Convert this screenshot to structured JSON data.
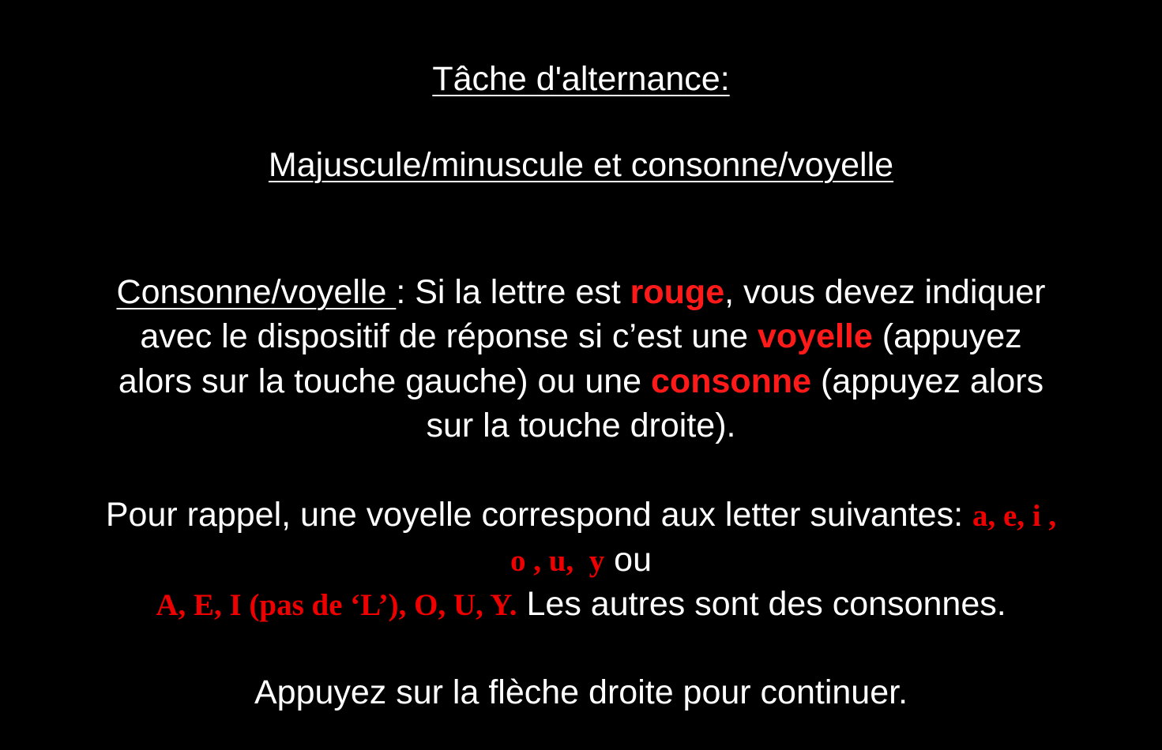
{
  "colors": {
    "background": "#000000",
    "text": "#ffffff",
    "highlight": "#ff1a1a"
  },
  "title": {
    "line1": "Tâche d'alternance:",
    "line2": "Majuscule/minuscule et consonne/voyelle"
  },
  "instructions": {
    "label": "Consonne/voyelle ",
    "p1_a": ": Si la lettre est ",
    "p1_rouge": "rouge",
    "p1_b": ", vous devez indiquer",
    "p2_a": "avec le dispositif de réponse si c’est une ",
    "p2_voyelle": "voyelle",
    "p2_b": " (appuyez",
    "p3_a": "alors sur la touche gauche) ou une ",
    "p3_consonne": "consonne",
    "p3_b": " (appuyez alors",
    "p4": "sur la touche droite)."
  },
  "reminder": {
    "r1_a": "Pour rappel, une voyelle correspond aux letter suivantes: ",
    "r1_letters": "a, e, i ,",
    "r2_letters": "o , u,  y",
    "r2_b": " ou",
    "r3_letters": "A, E, I (pas de ‘L’), O, U, Y.",
    "r3_b": " Les autres sont des consonnes."
  },
  "footer": {
    "continue": "Appuyez sur la flèche droite pour continuer."
  }
}
